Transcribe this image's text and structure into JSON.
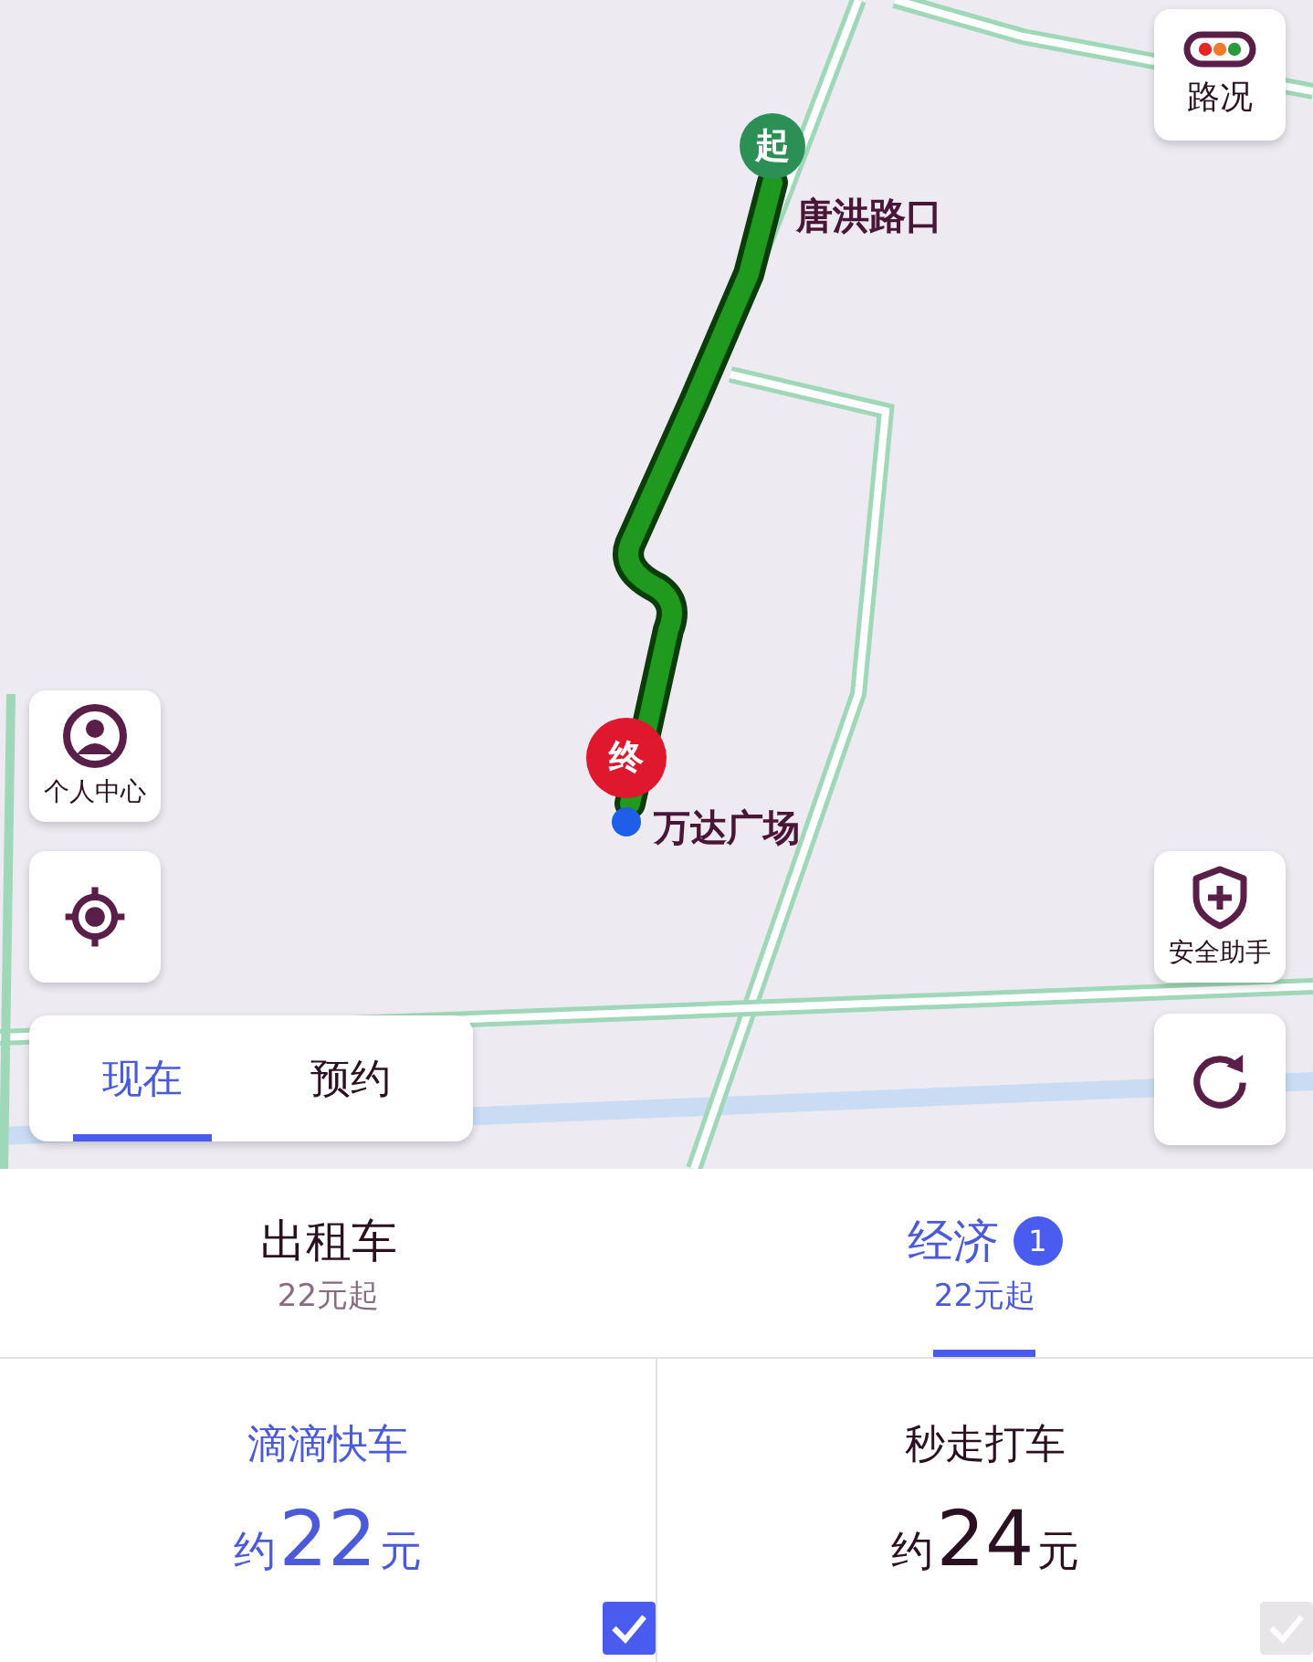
{
  "map": {
    "kind": "picture",
    "markers": [
      {
        "kind": "start",
        "label": "起",
        "place": "唐洪路口"
      },
      {
        "kind": "end",
        "label": "终",
        "place": "万达广场"
      }
    ],
    "buttons": [
      {
        "kind": "traffic",
        "label": "路况"
      },
      {
        "kind": "profile",
        "label": "个人中心"
      },
      {
        "kind": "locate"
      },
      {
        "kind": "safety",
        "label": "安全助手"
      },
      {
        "kind": "refresh"
      }
    ],
    "time_tabs": [
      {
        "label": "现在",
        "selected": true
      },
      {
        "label": "预约",
        "selected": false
      }
    ]
  },
  "categories": [
    {
      "label": "出租车",
      "price": "22元起",
      "selected": false
    },
    {
      "label": "经济",
      "badge": "1",
      "price": "22元起",
      "selected": true
    }
  ],
  "options": [
    {
      "name": "滴滴快车",
      "prefix": "约",
      "price": "22",
      "unit": "元",
      "checked": true
    },
    {
      "name": "秒走打车",
      "prefix": "约",
      "price": "24",
      "unit": "元",
      "checked": false
    }
  ]
}
